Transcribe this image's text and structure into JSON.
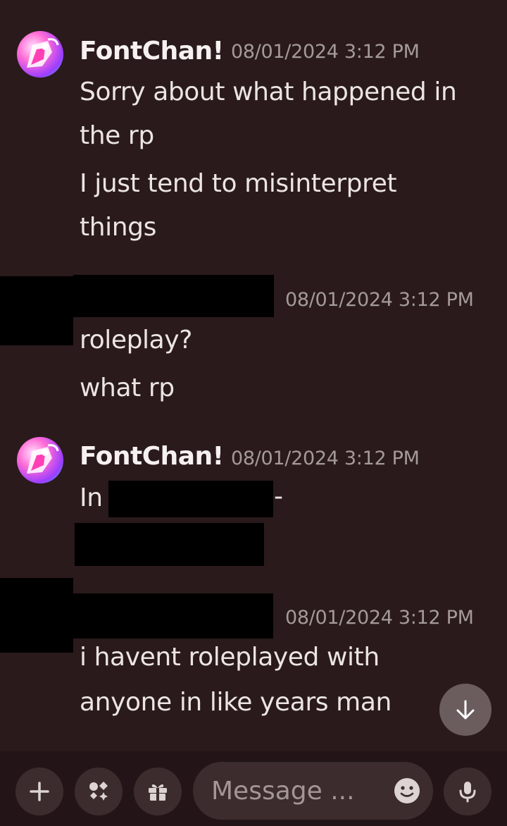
{
  "messages": [
    {
      "author": "FontChan!",
      "timestamp": "08/01/2024 3:12 PM",
      "lines": [
        "Sorry about what happened in",
        "the rp",
        "I just tend to misinterpret",
        "things"
      ]
    },
    {
      "author": "",
      "timestamp": "08/01/2024 3:12 PM",
      "lines": [
        "roleplay?",
        "what rp"
      ]
    },
    {
      "author": "FontChan!",
      "timestamp": "08/01/2024 3:12 PM",
      "lines": [
        "In",
        "-"
      ]
    },
    {
      "author": "",
      "timestamp": "08/01/2024 3:12 PM",
      "lines": [
        "i havent roleplayed with",
        "anyone in like years man"
      ]
    }
  ],
  "composer": {
    "placeholder": "Message ...",
    "buttons": [
      "plus-icon",
      "apps-icon",
      "gift-icon",
      "emoji-icon",
      "microphone-icon"
    ]
  },
  "icons": {
    "scroll": "arrow-down-icon"
  },
  "colors": {
    "background": "#2a1a1b",
    "composer_bg": "#231517",
    "button_bg": "#3c2c2d",
    "timestamp": "#a49a9a"
  }
}
